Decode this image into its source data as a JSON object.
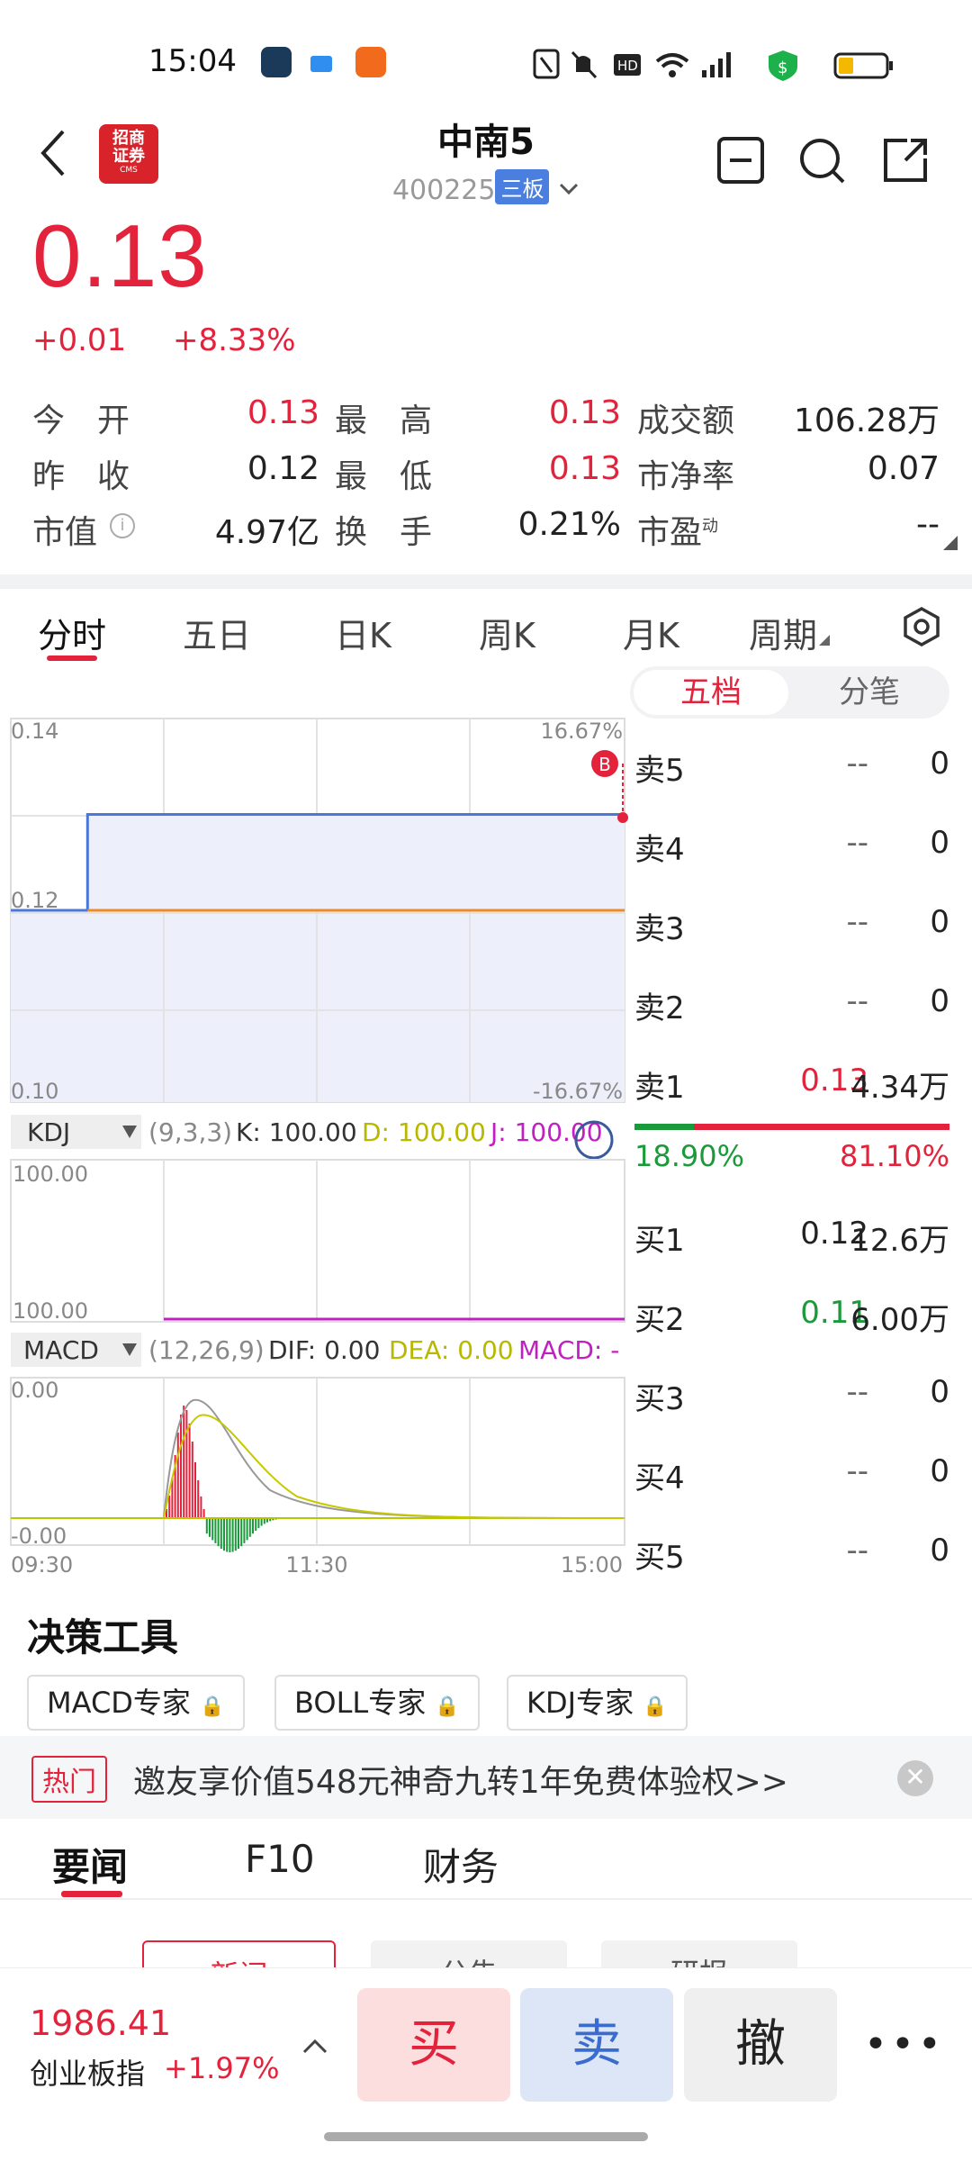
{
  "status_bar": {
    "time": "15:04"
  },
  "header": {
    "logo_line1": "招商",
    "logo_line2": "证券",
    "logo_sub": "CMS",
    "title": "中南5",
    "code": "400225",
    "board": "三板"
  },
  "quote": {
    "price": "0.13",
    "change": "+0.01",
    "change_pct": "+8.33%"
  },
  "stats": {
    "open_label": "今　开",
    "open": "0.13",
    "high_label": "最　高",
    "high": "0.13",
    "turnover_label": "成交额",
    "turnover": "106.28万",
    "prev_label": "昨　收",
    "prev": "0.12",
    "low_label": "最　低",
    "low": "0.13",
    "pb_label": "市净率",
    "pb": "0.07",
    "mcap_label": "市值",
    "mcap": "4.97亿",
    "turnrate_label": "换　手",
    "turnrate": "0.21%",
    "pe_label": "市盈",
    "pe_sup": "动",
    "pe": "--"
  },
  "tabs": [
    "分时",
    "五日",
    "日K",
    "周K",
    "月K",
    "周期"
  ],
  "order_book": {
    "toggle": [
      "五档",
      "分笔"
    ],
    "asks": [
      {
        "label": "卖5",
        "price": "--",
        "vol": "0"
      },
      {
        "label": "卖4",
        "price": "--",
        "vol": "0"
      },
      {
        "label": "卖3",
        "price": "--",
        "vol": "0"
      },
      {
        "label": "卖2",
        "price": "--",
        "vol": "0"
      },
      {
        "label": "卖1",
        "price": "0.13",
        "vol": "4.34万"
      }
    ],
    "ratio_buy": "18.90%",
    "ratio_sell": "81.10%",
    "ratio_buy_fraction": 0.189,
    "bids": [
      {
        "label": "买1",
        "price": "0.12",
        "vol": "12.6万"
      },
      {
        "label": "买2",
        "price": "0.11",
        "vol": "6.00万"
      },
      {
        "label": "买3",
        "price": "--",
        "vol": "0"
      },
      {
        "label": "买4",
        "price": "--",
        "vol": "0"
      },
      {
        "label": "买5",
        "price": "--",
        "vol": "0"
      }
    ]
  },
  "chart_data": {
    "type": "line",
    "y_ticks_left": [
      "0.14",
      "0.12",
      "0.10"
    ],
    "y_ticks_right": [
      "16.67%",
      "-16.67%"
    ],
    "ylim": [
      0.1,
      0.14
    ],
    "x_ticks": [
      "09:30",
      "11:30",
      "15:00"
    ],
    "series": [
      {
        "color": "#4a78d8",
        "x": [
          "09:30",
          "10:00",
          "10:00",
          "15:00"
        ],
        "values": [
          0.12,
          0.12,
          0.13,
          0.13
        ]
      },
      {
        "color": "#f08a24",
        "x": [
          "10:00",
          "15:00"
        ],
        "values": [
          0.12,
          0.12
        ]
      }
    ],
    "marker": "B",
    "kdj": {
      "name": "KDJ",
      "params": "(9,3,3)",
      "k": "K: 100.00",
      "d": "D: 100.00",
      "j": "J: 100.00",
      "top": "100.00",
      "bottom": "100.00"
    },
    "macd": {
      "name": "MACD",
      "params": "(12,26,9)",
      "dif": "DIF: 0.00",
      "dea": "DEA: 0.00",
      "macd": "MACD: -",
      "top": "0.00",
      "bottom": "-0.00"
    }
  },
  "tools": {
    "title": "决策工具",
    "chips": [
      "MACD专家",
      "BOLL专家",
      "KDJ专家"
    ]
  },
  "promo": {
    "tag": "热门",
    "text": "邀友享价值548元神奇九转1年免费体验权>>"
  },
  "news_tabs": [
    "要闻",
    "F10",
    "财务"
  ],
  "news_subtabs": [
    "新闻",
    "公告",
    "研报"
  ],
  "index": {
    "value": "1986.41",
    "name": "创业板指",
    "pct": "+1.97%"
  },
  "actions": {
    "buy": "买",
    "sell": "卖",
    "cancel": "撤"
  },
  "colors": {
    "up": "#e2233b",
    "down": "#1a9a3a",
    "accent_blue": "#4a78d8"
  }
}
